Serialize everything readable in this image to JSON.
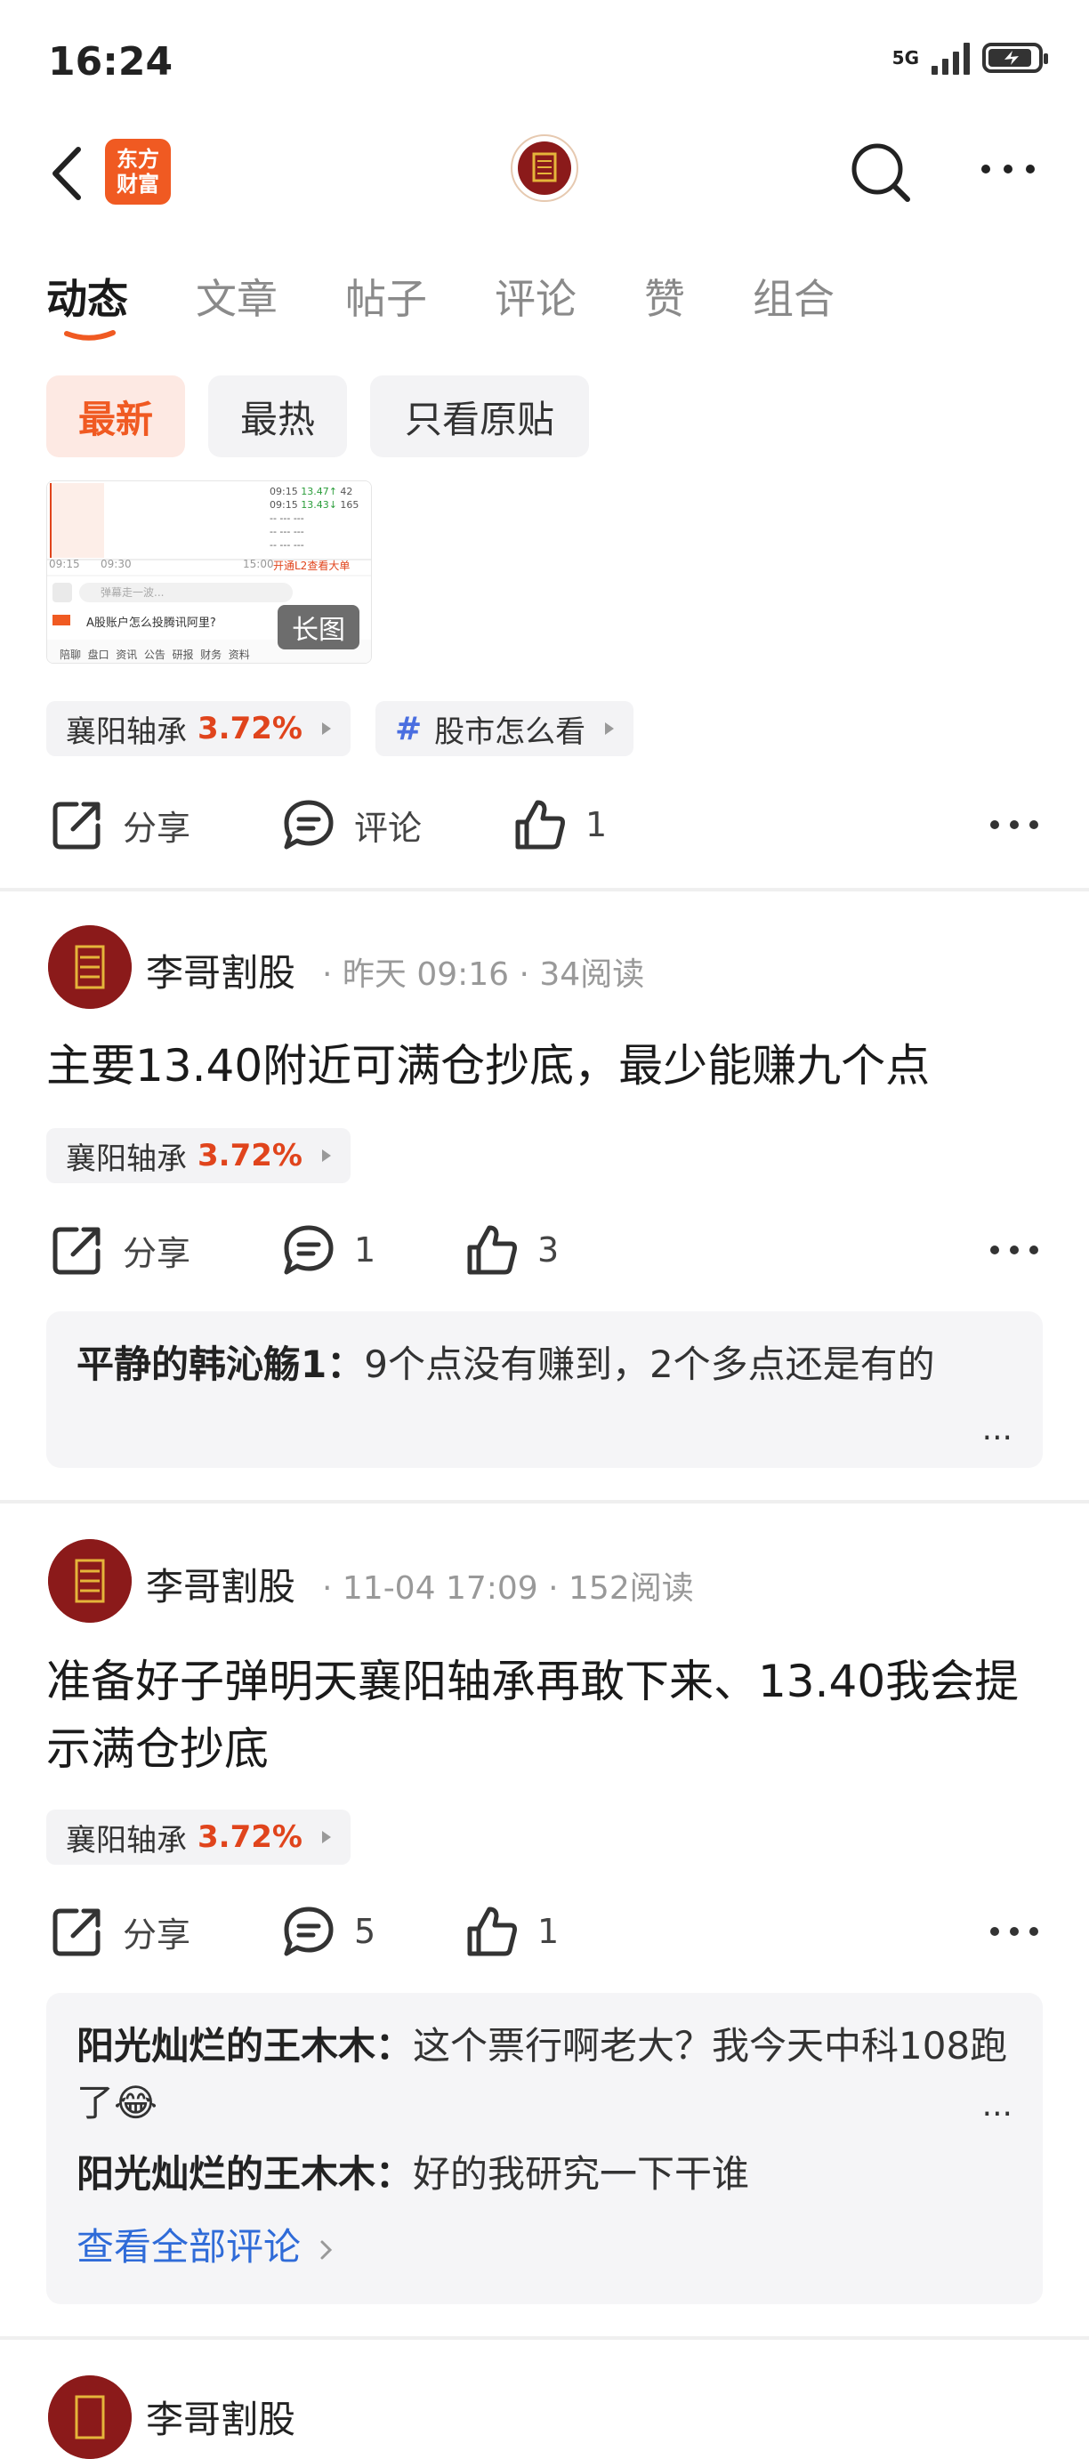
{
  "status_bar": {
    "time": "16:24",
    "network": "5G"
  },
  "header": {
    "logo_text_line1": "东方",
    "logo_text_line2": "财富"
  },
  "tabs": [
    {
      "label": "动态",
      "active": true
    },
    {
      "label": "文章",
      "active": false
    },
    {
      "label": "帖子",
      "active": false
    },
    {
      "label": "评论",
      "active": false
    },
    {
      "label": "赞",
      "active": false
    },
    {
      "label": "组合",
      "active": false
    }
  ],
  "filters": [
    {
      "label": "最新",
      "active": true
    },
    {
      "label": "最热",
      "active": false
    },
    {
      "label": "只看原贴",
      "active": false
    }
  ],
  "first_post": {
    "image_badge": "长图",
    "thumb_text": {
      "t1": "09:15",
      "t2": "09:30",
      "t3": "15:00",
      "p1": "13.47↑",
      "p2": "13.43↓",
      "v1": "42",
      "v2": "165",
      "l2": "开通L2查看大单",
      "input": "弹幕走一波...",
      "ad": "A股账户怎么投腾讯阿里?",
      "nav": "陪聊  盘口  资讯  公告  研报  财务  资料"
    },
    "stock_tag": {
      "name": "襄阳轴承",
      "pct": "3.72%"
    },
    "topic_tag": {
      "hash": "#",
      "name": "股市怎么看"
    },
    "actions": {
      "share": "分享",
      "comment": "评论",
      "like": "1"
    }
  },
  "posts": [
    {
      "author": "李哥割股",
      "meta": "· 昨天 09:16 · 34阅读",
      "text": "主要13.40附近可满仓抄底，最少能赚九个点",
      "stock_tag": {
        "name": "襄阳轴承",
        "pct": "3.72%"
      },
      "actions": {
        "share": "分享",
        "comment": "1",
        "like": "3"
      },
      "comments": [
        {
          "user": "平静的韩沁觞1：",
          "text": "9个点没有赚到，2个多点还是有的"
        }
      ],
      "more": "..."
    },
    {
      "author": "李哥割股",
      "meta": "· 11-04 17:09 · 152阅读",
      "text": "准备好子弹明天襄阳轴承再敢下来、13.40我会提示满仓抄底",
      "stock_tag": {
        "name": "襄阳轴承",
        "pct": "3.72%"
      },
      "actions": {
        "share": "分享",
        "comment": "5",
        "like": "1"
      },
      "comments": [
        {
          "user": "阳光灿烂的王木木：",
          "text": "这个票行啊老大？我今天中科108跑了😂"
        },
        {
          "user": "阳光灿烂的王木木：",
          "text": "好的我研究一下干谁"
        }
      ],
      "more": "...",
      "view_all": "查看全部评论"
    },
    {
      "author": "李哥割股"
    }
  ],
  "colors": {
    "accent": "#f05a22",
    "up": "#e0441c",
    "link": "#2f6bd8",
    "topic": "#4a6ee0"
  }
}
